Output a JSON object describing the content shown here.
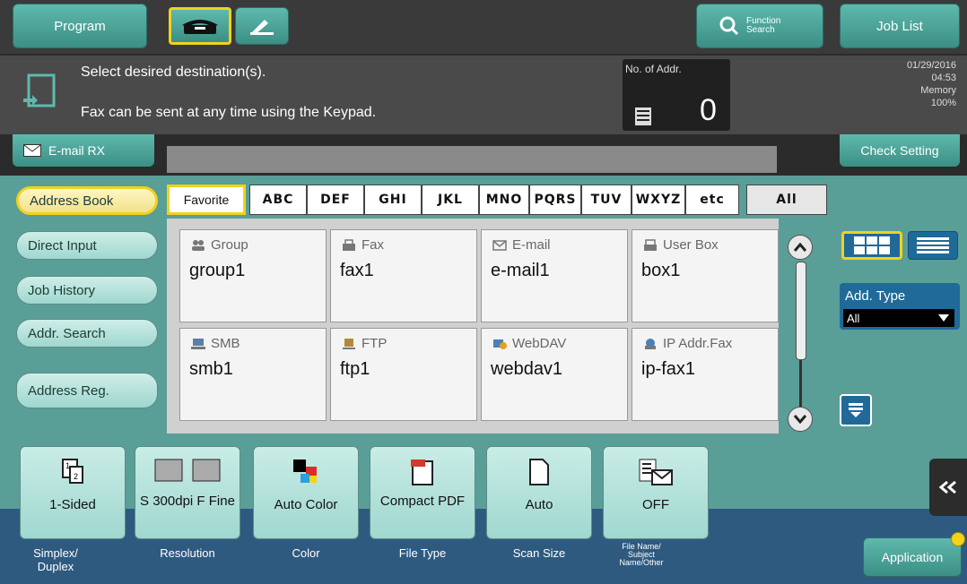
{
  "topbar": {
    "program_label": "Program",
    "function_search_label": "Function Search",
    "job_list_label": "Job List"
  },
  "message": {
    "line1": "Select desired destination(s).",
    "line2": "Fax can be sent at any time using the Keypad.",
    "no_of_addr_label": "No. of Addr.",
    "no_of_addr_value": "0"
  },
  "status": {
    "date": "01/29/2016",
    "time": "04:53",
    "memory_label": "Memory",
    "memory_value": "100%"
  },
  "email_rx_label": "E-mail RX",
  "check_setting_label": "Check Setting",
  "left_nav": [
    {
      "label": "Address Book",
      "selected": true
    },
    {
      "label": "Direct Input"
    },
    {
      "label": "Job History"
    },
    {
      "label": "Addr. Search"
    },
    {
      "label": "Address Reg."
    }
  ],
  "index_tabs": [
    "Favorite",
    "ABC",
    "DEF",
    "GHI",
    "JKL",
    "MNO",
    "PQRS",
    "TUV",
    "WXYZ",
    "etc",
    "All"
  ],
  "destinations": [
    {
      "type": "Group",
      "icon": "group-icon",
      "name": "group1"
    },
    {
      "type": "Fax",
      "icon": "fax-icon",
      "name": "fax1"
    },
    {
      "type": "E-mail",
      "icon": "email-icon",
      "name": "e-mail1"
    },
    {
      "type": "User Box",
      "icon": "user-box-icon",
      "name": "box1"
    },
    {
      "type": "SMB",
      "icon": "smb-icon",
      "name": "smb1"
    },
    {
      "type": "FTP",
      "icon": "ftp-icon",
      "name": "ftp1"
    },
    {
      "type": "WebDAV",
      "icon": "webdav-icon",
      "name": "webdav1"
    },
    {
      "type": "IP Addr.Fax",
      "icon": "ip-fax-icon",
      "name": "ip-fax1"
    }
  ],
  "add_type": {
    "label": "Add. Type",
    "value": "All"
  },
  "settings": [
    {
      "value": "1-Sided",
      "caption": "Simplex/ Duplex",
      "icon": "simplex-icon"
    },
    {
      "value": "S 300dpi F Fine",
      "caption": "Resolution",
      "icon": "resolution-icon"
    },
    {
      "value": "Auto Color",
      "caption": "Color",
      "icon": "color-icon"
    },
    {
      "value": "Compact PDF",
      "caption": "File Type",
      "icon": "pdf-icon"
    },
    {
      "value": "Auto",
      "caption": "Scan Size",
      "icon": "scan-size-icon"
    },
    {
      "value": "OFF",
      "caption": "File Name/ Subject Name/Other",
      "icon": "file-name-icon"
    }
  ],
  "application_label": "Application",
  "colors": {
    "accent_yellow": "#f2d21a",
    "teal": "#5a9e98",
    "blue": "#1f6a98"
  }
}
